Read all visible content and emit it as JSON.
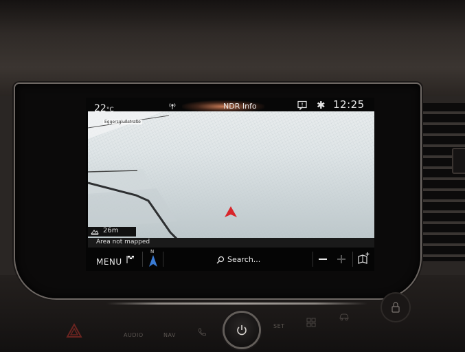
{
  "status_bar": {
    "temperature": "22",
    "temperature_unit": "°C",
    "station": "NDR Info",
    "time": "12:25"
  },
  "map": {
    "street_name": "Eggersglußstraße",
    "scale": "26m",
    "notice": "Area not mapped",
    "compass_heading": "N"
  },
  "bottom_bar": {
    "menu_label": "MENU",
    "search_label": "Search..."
  },
  "hardware": {
    "audio_label": "AUDIO",
    "nav_label": "NAV",
    "set_label": "SET"
  },
  "colors": {
    "vehicle_marker": "#d8252a",
    "compass_arrow": "#3a7bd5",
    "road": "#2d2f31"
  }
}
